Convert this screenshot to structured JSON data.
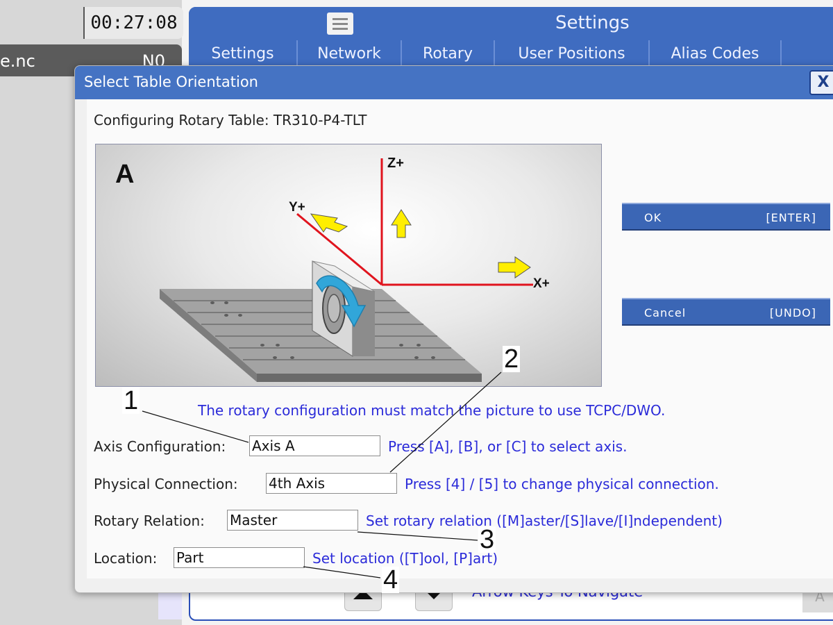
{
  "header": {
    "timer": "00:27:08",
    "program_name": "e.nc",
    "program_line": "N0"
  },
  "settings": {
    "title": "Settings",
    "tabs": [
      {
        "label": "Settings"
      },
      {
        "label": "Network"
      },
      {
        "label": "Rotary"
      },
      {
        "label": "User Positions"
      },
      {
        "label": "Alias Codes"
      }
    ],
    "nav_hint": "Arrow Keys To Navigate",
    "key_label": "A"
  },
  "dialog": {
    "title": "Select Table Orientation",
    "close_label": "X",
    "config_label": "Configuring Rotary Table: TR310-P4-TLT",
    "diagram": {
      "view_letter": "A",
      "axes": {
        "z": "Z+",
        "y": "Y+",
        "x": "X+"
      }
    },
    "info_message": "The rotary configuration must match the picture to use TCPC/DWO.",
    "ok_button": {
      "label": "OK",
      "key": "[ENTER]"
    },
    "cancel_button": {
      "label": "Cancel",
      "key": "[UNDO]"
    },
    "fields": {
      "axis_configuration": {
        "label": "Axis Configuration:",
        "value": "Axis A",
        "hint": "Press [A], [B], or [C] to select axis."
      },
      "physical_connection": {
        "label": "Physical Connection:",
        "value": "4th Axis",
        "hint": "Press [4] / [5] to change physical connection."
      },
      "rotary_relation": {
        "label": "Rotary Relation:",
        "value": "Master",
        "hint": "Set rotary relation ([M]aster/[S]lave/[I]ndependent)"
      },
      "location": {
        "label": "Location:",
        "value": "Part",
        "hint": "Set location ([T]ool, [P]art)"
      }
    }
  },
  "callouts": [
    "1",
    "2",
    "3",
    "4"
  ],
  "colors": {
    "header_blue": "#3f6cc0",
    "button_blue": "#3b66b5",
    "hint_blue": "#2b2bd9",
    "axis_red": "#e0141e",
    "arrow_yellow": "#ffee00"
  }
}
